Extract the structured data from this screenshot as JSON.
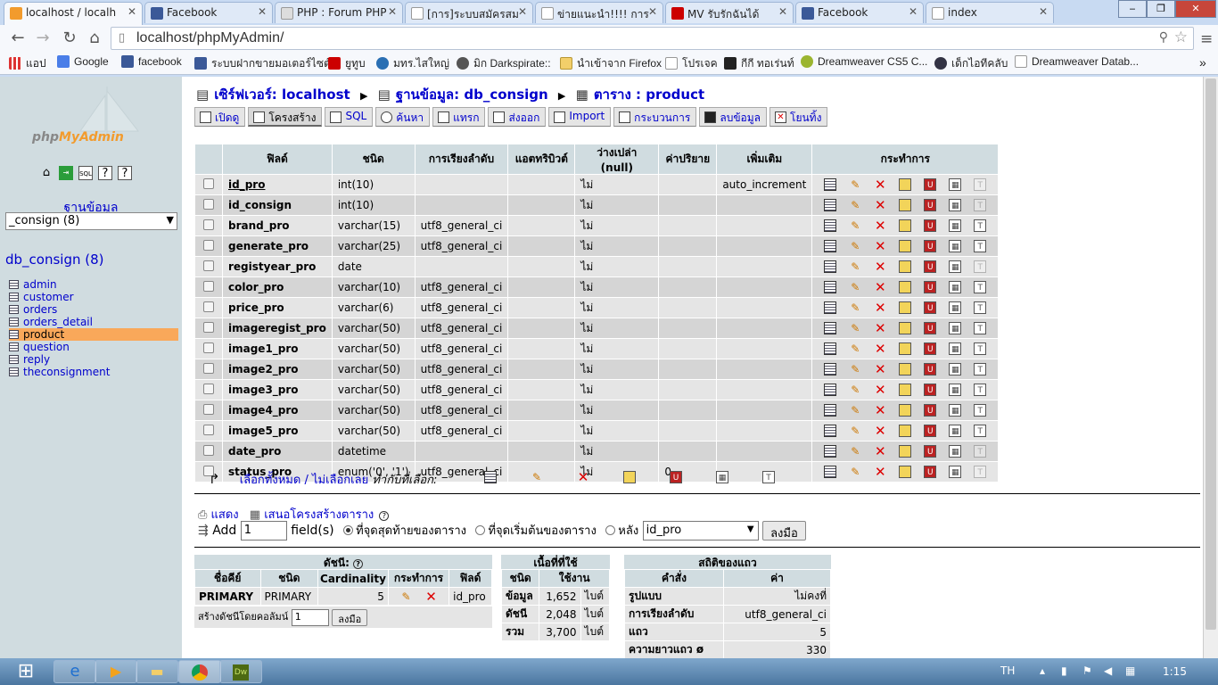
{
  "browser": {
    "tabs": [
      "localhost / localh",
      "Facebook",
      "PHP : Forum PHP",
      "[การ]ระบบสมัครสม",
      "ข่ายแนะนำ!!!! การ",
      "MV รับรักฉันได้",
      "Facebook",
      "index"
    ],
    "url": "localhost/phpMyAdmin/",
    "bookmarks": [
      "แอป",
      "Google",
      "facebook",
      "ระบบฝากขายมอเตอร์ไซต์",
      "ยูทูบ",
      "มทร.ไสใหญ่",
      "มิก Darkspirate::",
      "นำเข้าจาก Firefox",
      "โปรเจค",
      "กีกี ทอเร่นท์",
      "Dreamweaver CS5 C...",
      "เด็กไอทีคลับ",
      "Dreamweaver Datab..."
    ]
  },
  "sidebar": {
    "logo_a": "php",
    "logo_b": "MyAdmin",
    "db_label": "ฐานข้อมูล",
    "db_select": "_consign (8)",
    "db_name": "db_consign (8)",
    "tables": [
      "admin",
      "customer",
      "orders",
      "orders_detail",
      "product",
      "question",
      "reply",
      "theconsignment"
    ]
  },
  "breadcrumb": {
    "server": "เซิร์ฟเวอร์: localhost",
    "database": "ฐานข้อมูล: db_consign",
    "table": "ตาราง : product"
  },
  "tabs": [
    "เปิดดู",
    "โครงสร้าง",
    "SQL",
    "ค้นหา",
    "แทรก",
    "ส่งออก",
    "Import",
    "กระบวนการ",
    "ลบข้อมูล",
    "โยนทิ้ง"
  ],
  "structure": {
    "headers": [
      "ฟิลด์",
      "ชนิด",
      "การเรียงลำดับ",
      "แอตทริบิวต์",
      "ว่างเปล่า (null)",
      "ค่าปริยาย",
      "เพิ่มเติม",
      "กระทำการ"
    ],
    "rows": [
      {
        "field": "id_pro",
        "type": "int(10)",
        "collation": "",
        "attr": "",
        "null": "ไม่",
        "default": "",
        "extra": "auto_increment"
      },
      {
        "field": "id_consign",
        "type": "int(10)",
        "collation": "",
        "attr": "",
        "null": "ไม่",
        "default": "",
        "extra": ""
      },
      {
        "field": "brand_pro",
        "type": "varchar(15)",
        "collation": "utf8_general_ci",
        "attr": "",
        "null": "ไม่",
        "default": "",
        "extra": ""
      },
      {
        "field": "generate_pro",
        "type": "varchar(25)",
        "collation": "utf8_general_ci",
        "attr": "",
        "null": "ไม่",
        "default": "",
        "extra": ""
      },
      {
        "field": "registyear_pro",
        "type": "date",
        "collation": "",
        "attr": "",
        "null": "ไม่",
        "default": "",
        "extra": ""
      },
      {
        "field": "color_pro",
        "type": "varchar(10)",
        "collation": "utf8_general_ci",
        "attr": "",
        "null": "ไม่",
        "default": "",
        "extra": ""
      },
      {
        "field": "price_pro",
        "type": "varchar(6)",
        "collation": "utf8_general_ci",
        "attr": "",
        "null": "ไม่",
        "default": "",
        "extra": ""
      },
      {
        "field": "imageregist_pro",
        "type": "varchar(50)",
        "collation": "utf8_general_ci",
        "attr": "",
        "null": "ไม่",
        "default": "",
        "extra": ""
      },
      {
        "field": "image1_pro",
        "type": "varchar(50)",
        "collation": "utf8_general_ci",
        "attr": "",
        "null": "ไม่",
        "default": "",
        "extra": ""
      },
      {
        "field": "image2_pro",
        "type": "varchar(50)",
        "collation": "utf8_general_ci",
        "attr": "",
        "null": "ไม่",
        "default": "",
        "extra": ""
      },
      {
        "field": "image3_pro",
        "type": "varchar(50)",
        "collation": "utf8_general_ci",
        "attr": "",
        "null": "ไม่",
        "default": "",
        "extra": ""
      },
      {
        "field": "image4_pro",
        "type": "varchar(50)",
        "collation": "utf8_general_ci",
        "attr": "",
        "null": "ไม่",
        "default": "",
        "extra": ""
      },
      {
        "field": "image5_pro",
        "type": "varchar(50)",
        "collation": "utf8_general_ci",
        "attr": "",
        "null": "ไม่",
        "default": "",
        "extra": ""
      },
      {
        "field": "date_pro",
        "type": "datetime",
        "collation": "",
        "attr": "",
        "null": "ไม่",
        "default": "",
        "extra": ""
      },
      {
        "field": "status_pro",
        "type": "enum('0', '1')",
        "collation": "utf8_general_ci",
        "attr": "",
        "null": "ไม่",
        "default": "0",
        "extra": ""
      }
    ]
  },
  "selection": {
    "check_all": "เลือกทั้งหมด",
    "sep": " / ",
    "uncheck_all": "ไม่เลือกเลย",
    "with_selected": "ทำกับที่เลือก:"
  },
  "actions": {
    "print": "แสดง",
    "propose": "เสนอโครงสร้างตาราง"
  },
  "add": {
    "label": "Add",
    "count": "1",
    "fields": "field(s)",
    "opt_end": "ที่จุดสุดท้ายของตาราง",
    "opt_begin": "ที่จุดเริ่มต้นของตาราง",
    "opt_after": "หลัง",
    "after_field": "id_pro",
    "go": "ลงมือ"
  },
  "indexes": {
    "title": "ดัชนี:",
    "headers": [
      "ชื่อคีย์",
      "ชนิด",
      "Cardinality",
      "กระทำการ",
      "ฟิลด์"
    ],
    "row": {
      "key": "PRIMARY",
      "type": "PRIMARY",
      "cardinality": "5",
      "field": "id_pro"
    },
    "create_label": "สร้างดัชนีโดยคอลัมน์",
    "create_count": "1",
    "go": "ลงมือ"
  },
  "space": {
    "title": "เนื้อที่ที่ใช้",
    "headers": [
      "ชนิด",
      "ใช้งาน"
    ],
    "rows": [
      [
        "ข้อมูล",
        "1,652",
        "ไบต์"
      ],
      [
        "ดัชนี",
        "2,048",
        "ไบต์"
      ],
      [
        "รวม",
        "3,700",
        "ไบต์"
      ]
    ]
  },
  "stats": {
    "title": "สถิติของแถว",
    "headers": [
      "คำสั่ง",
      "ค่า"
    ],
    "rows": [
      [
        "รูปแบบ",
        "ไม่คงที่"
      ],
      [
        "การเรียงลำดับ",
        "utf8_general_ci"
      ],
      [
        "แถว",
        "5"
      ],
      [
        "ความยาวแถว ø",
        "330"
      ]
    ]
  },
  "taskbar": {
    "lang": "TH",
    "time": "1:15"
  }
}
